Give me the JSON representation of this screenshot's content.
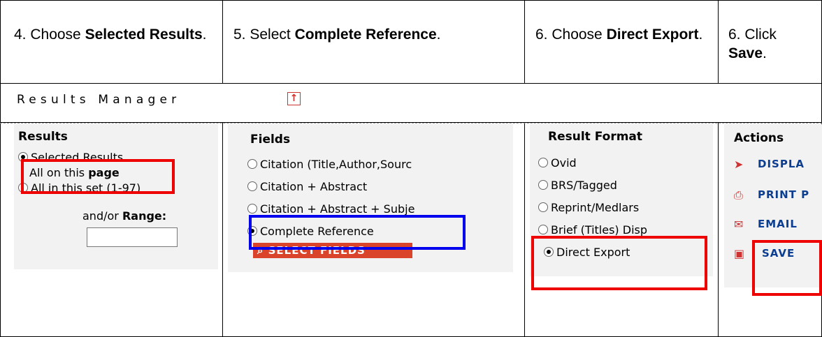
{
  "steps": [
    {
      "prefix": "4. Choose ",
      "bold": "Selected Results",
      "suffix": "."
    },
    {
      "prefix": "5. Select ",
      "bold": "Complete Reference",
      "suffix": "."
    },
    {
      "prefix": "6. Choose ",
      "bold": "Direct Export",
      "suffix": "."
    },
    {
      "prefix": "6. Click ",
      "bold": "Save",
      "suffix": "."
    }
  ],
  "results_manager": {
    "title": "Results Manager",
    "up_icon": "up-arrow-icon",
    "results": {
      "heading": "Results",
      "options": [
        "Selected Results",
        "All on this ",
        "All in this set (1-97)"
      ],
      "page_bold": "page",
      "selected": 0,
      "range_prefix": "and/or ",
      "range_label": "Range:"
    },
    "fields": {
      "heading": "Fields",
      "options": [
        "Citation (Title,Author,Sourc",
        "Citation + Abstract",
        "Citation + Abstract + Subje",
        "Complete Reference"
      ],
      "selected": 3,
      "select_button": "SELECT FIELDS"
    },
    "result_format": {
      "heading": "Result Format",
      "options": [
        "Ovid",
        "BRS/Tagged",
        "Reprint/Medlars",
        "Brief (Titles) Disp",
        "Direct Export"
      ],
      "selected": 4
    },
    "actions": {
      "heading": "Actions",
      "items": [
        {
          "label": "DISPLA",
          "icon": "display-icon"
        },
        {
          "label": "PRINT P",
          "icon": "print-icon"
        },
        {
          "label": "EMAIL",
          "icon": "email-icon"
        },
        {
          "label": "SAVE",
          "icon": "save-icon"
        }
      ]
    }
  },
  "colors": {
    "highlight_red": "#e00000",
    "highlight_blue": "#0000e0",
    "action_link": "#0b3d91",
    "button_red": "#d9442b"
  }
}
